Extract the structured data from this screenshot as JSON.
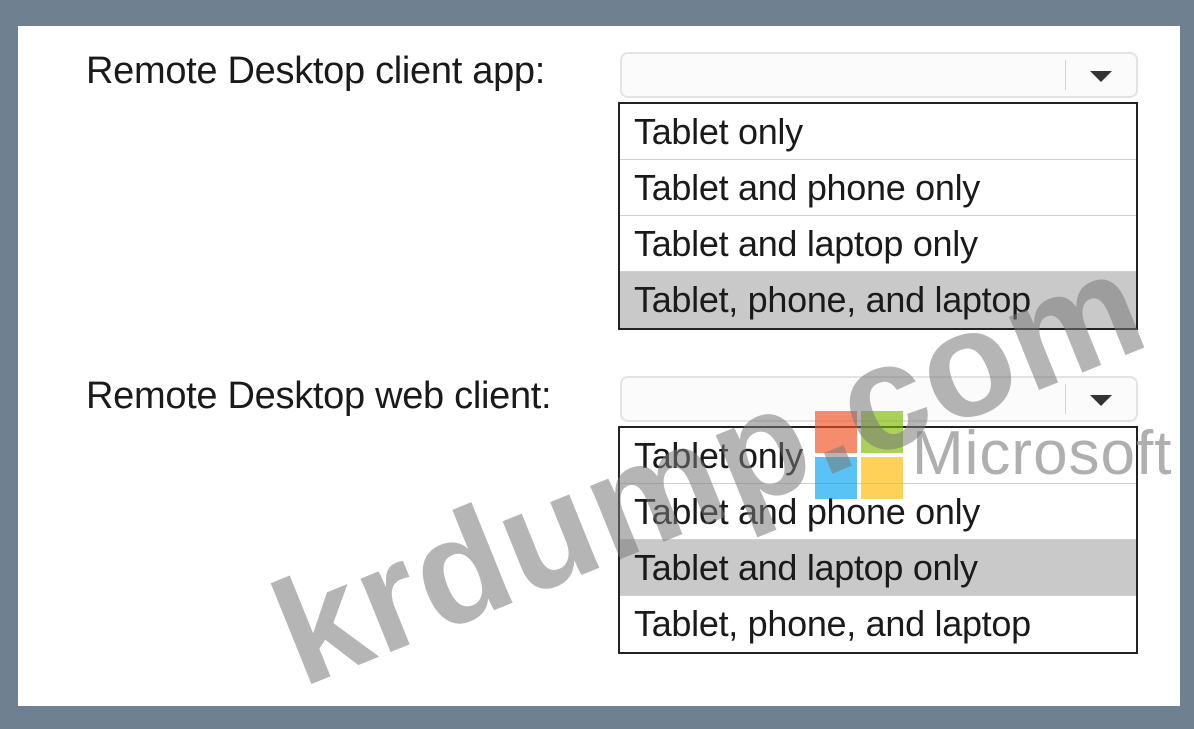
{
  "rows": [
    {
      "label": "Remote Desktop client app:",
      "selected_value": "",
      "options": [
        "Tablet only",
        "Tablet and phone only",
        "Tablet and laptop only",
        "Tablet, phone, and laptop"
      ],
      "highlighted_index": 3
    },
    {
      "label": "Remote Desktop web client:",
      "selected_value": "",
      "options": [
        "Tablet only",
        "Tablet and phone only",
        "Tablet and laptop only",
        "Tablet, phone, and laptop"
      ],
      "highlighted_index": 2
    }
  ],
  "logo": {
    "text": "Microsoft",
    "colors": [
      "#f25022",
      "#7fba00",
      "#00a4ef",
      "#ffb900"
    ]
  },
  "watermark": "krdump.com"
}
